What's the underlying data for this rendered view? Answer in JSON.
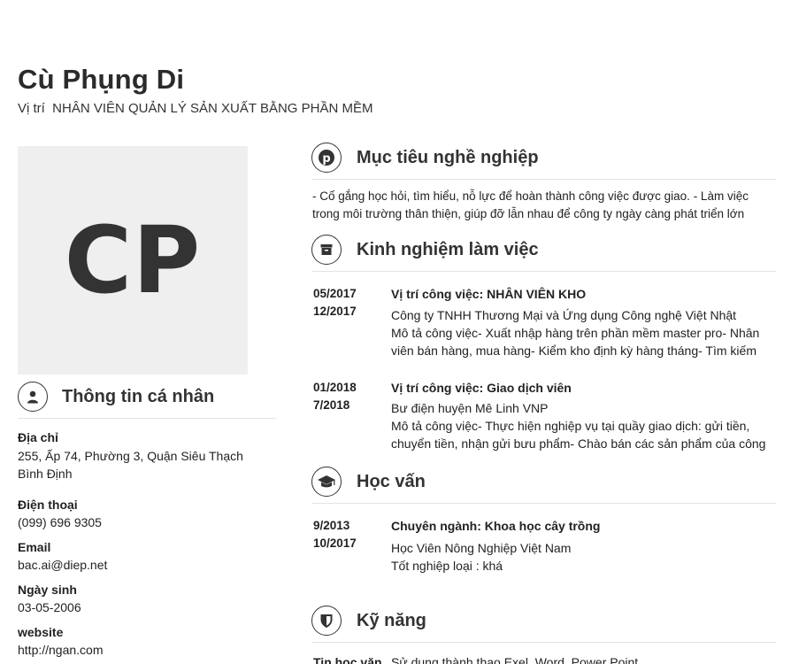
{
  "header": {
    "name": "Cù Phụng Di",
    "position": "Vị trí  NHÂN VIÊN QUẢN LÝ SẢN XUẤT BẰNG PHẦN MỀM"
  },
  "avatar": {
    "initials": "CP"
  },
  "personal": {
    "title": "Thông tin cá nhân",
    "icon": "user-icon",
    "fields": [
      {
        "label": "Địa chỉ",
        "value": "255, Ấp 74, Phường 3, Quận Siêu Thạch\nBình Định"
      },
      {
        "label": "Điện thoại",
        "value": "(099) 696 9305"
      },
      {
        "label": "Email",
        "value": "bac.ai@diep.net"
      },
      {
        "label": "Ngày sinh",
        "value": "03-05-2006"
      },
      {
        "label": "website",
        "value": "http://ngan.com"
      }
    ]
  },
  "objective": {
    "title": "Mục tiêu nghề nghiệp",
    "icon": "pinterest-icon",
    "text": "- Cố gắng học hỏi, tìm hiểu, nỗ lực để hoàn thành công việc được giao. - Làm việc trong môi trường thân thiện, giúp đỡ lẫn nhau để công ty ngày càng phát triển lớn"
  },
  "experience": {
    "title": "Kinh nghiệm làm việc",
    "icon": "archive-icon",
    "entries": [
      {
        "start": "05/2017",
        "end": "12/2017",
        "title": "Vị trí công việc: NHÂN VIÊN KHO",
        "company": "Công ty TNHH Thương Mại và Ứng dụng Công nghệ Việt Nhật",
        "description": "Mô tả công việc-  Xuất nhập hàng trên phần mềm master pro-  Nhân viên bán hàng, mua hàng-  Kiểm kho định kỳ hàng tháng- Tìm kiếm"
      },
      {
        "start": "01/2018",
        "end": "7/2018",
        "title": "Vị trí công việc: Giao dịch viên",
        "company": "Bư điện huyện Mê Linh VNP",
        "description": "Mô tả công việc-  Thực hiện nghiệp vụ tại quầy giao dịch: gửi tiền, chuyển tiền, nhận gửi bưu phẩm-  Chào bán các sản phẩm của công"
      }
    ]
  },
  "education": {
    "title": "Học vấn",
    "icon": "graduation-cap-icon",
    "entries": [
      {
        "start": "9/2013",
        "end": "10/2017",
        "title": "Chuyên ngành: Khoa học cây trồng",
        "school": "Học Viên Nông Nghiệp Việt Nam",
        "result": "Tốt nghiệp loại : khá"
      }
    ]
  },
  "skills": {
    "title": "Kỹ năng",
    "icon": "shield-icon",
    "items": [
      {
        "name": "Tin học văn",
        "description": "Sử dụng thành thạo Exel, Word, Power Point"
      }
    ]
  }
}
